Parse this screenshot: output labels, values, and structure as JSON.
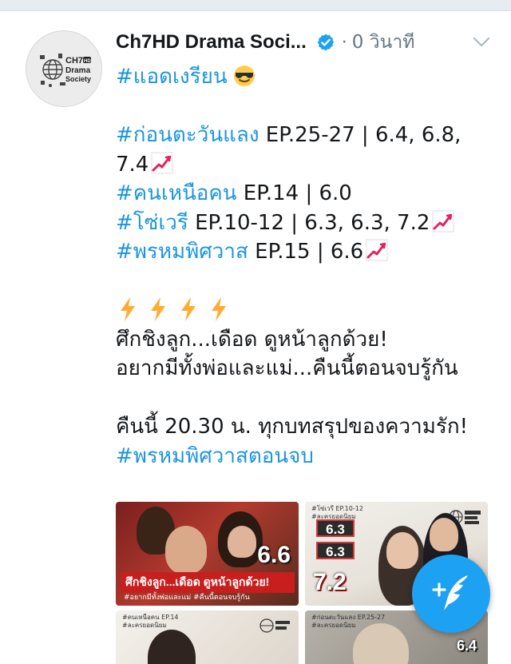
{
  "tweet": {
    "display_name": "Ch7HD Drama Soci...",
    "separator": "·",
    "time": "0 วินาที",
    "avatar": {
      "line1": "CH7",
      "line2": "Drama",
      "line3": "Society",
      "badge": "HD"
    },
    "lines": [
      {
        "hashtag": "#แอดเงรียน",
        "text": "",
        "emoji": "sunglasses-face"
      },
      {
        "gap": true
      },
      {
        "hashtag": "#ก่อนตะวันแลง",
        "text": " EP.25-27 | 6.4, 6.8,",
        "emoji": ""
      },
      {
        "hashtag": "",
        "text": "7.4",
        "emoji": "chart-increasing"
      },
      {
        "hashtag": "#คนเหนือคน",
        "text": " EP.14 | 6.0",
        "emoji": ""
      },
      {
        "hashtag": "#โซ่เวรี",
        "text": " EP.10-12 | 6.3, 6.3, 7.2",
        "emoji": "chart-increasing"
      },
      {
        "hashtag": "#พรหมพิศวาส",
        "text": " EP.15 | 6.6",
        "emoji": "chart-increasing"
      },
      {
        "gap": true
      },
      {
        "bolts": 4
      },
      {
        "hashtag": "",
        "text": "ศึกชิงลูก...เดือด ดูหน้าลูกด้วย!",
        "emoji": ""
      },
      {
        "hashtag": "",
        "text": "อยากมีทั้งพ่อและแม่...คืนนี้ตอนจบรู้กัน",
        "emoji": ""
      },
      {
        "gap": true
      },
      {
        "hashtag": "",
        "text": "คืนนี้ 20.30 น. ทุกบทสรุปของความรัก!",
        "emoji": ""
      },
      {
        "hashtag": "#พรหมพิศวาสตอนจบ",
        "text": "",
        "emoji": ""
      }
    ]
  },
  "media": {
    "thumb1": {
      "score": "6.6",
      "caption": "ศึกชิงลูก...เดือด ดูหน้าลูกด้วย!",
      "sub": "#อยากมีทั้งพ่อและแม่ #คืนนี้ตอนจบรู้กัน"
    },
    "thumb2": {
      "label": "#โซ่เวรี EP.10-12",
      "label2": "#ละครยอดนิยม",
      "scores": [
        "6.3",
        "6.3"
      ],
      "big": "7.2"
    },
    "thumb3": {
      "label": "#คนเหนือคน EP.14",
      "label2": "#ละครยอดนิยม"
    },
    "thumb4": {
      "label": "#ก่อนตะวันแลง EP.25-27",
      "label2": "#ละครยอดนิยม",
      "score": "6.4"
    }
  },
  "fab": {
    "icon": "compose-quill-plus-icon"
  },
  "colors": {
    "hashtag": "#1b95e0",
    "fab": "#1da1f2",
    "verified": "#1da1f2",
    "meta": "#657786"
  }
}
